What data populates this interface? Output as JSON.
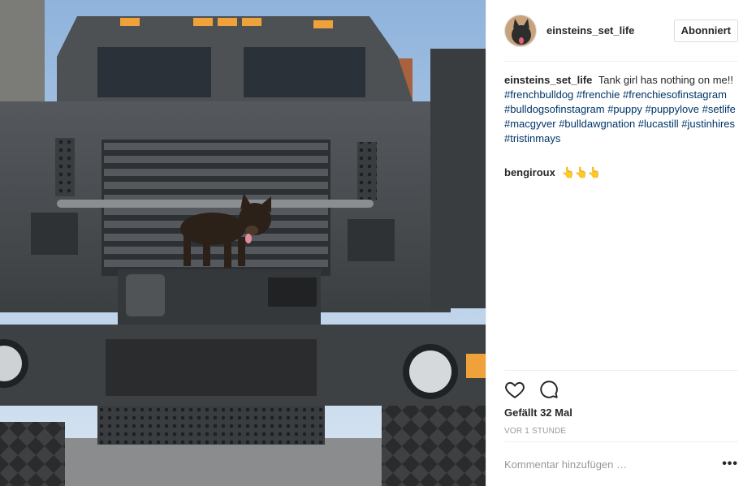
{
  "post": {
    "username": "einsteins_set_life",
    "follow_label": "Abonniert",
    "caption_text": "Tank girl has nothing on me!!",
    "hashtags": [
      "#frenchbulldog",
      "#frenchie",
      "#frenchiesofinstagram",
      "#bulldogsofinstagram",
      "#puppy",
      "#puppylove",
      "#setlife",
      "#macgyver",
      "#bulldawgnation",
      "#lucastill",
      "#justinhires",
      "#tristinmays"
    ],
    "comments": [
      {
        "username": "bengiroux",
        "text": "👆👆👆"
      }
    ],
    "likes_text": "Gefällt 32 Mal",
    "time_text": "VOR 1 STUNDE",
    "comment_placeholder": "Kommentar hinzufügen …",
    "more_label": "•••"
  },
  "icons": {
    "like": "heart-icon",
    "comment": "comment-bubble-icon",
    "more": "more-options-icon"
  },
  "colors": {
    "hashtag": "#003569",
    "text": "#262626",
    "muted": "#999999",
    "border": "#efefef"
  }
}
